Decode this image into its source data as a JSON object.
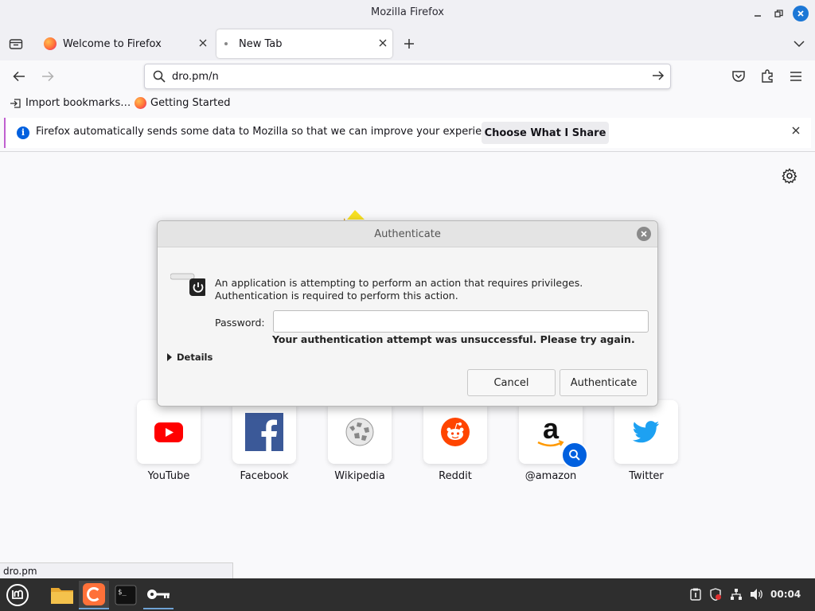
{
  "window": {
    "title": "Mozilla Firefox"
  },
  "tabs": [
    {
      "label": "Welcome to Firefox",
      "active": false
    },
    {
      "label": "New Tab",
      "active": true
    }
  ],
  "navbar": {
    "url": "dro.pm/n"
  },
  "bookmarks": [
    {
      "label": "Import bookmarks…"
    },
    {
      "label": "Getting Started"
    }
  ],
  "notification": {
    "message": "Firefox automatically sends some data to Mozilla so that we can improve your experience.",
    "button": "Choose What I Share"
  },
  "top_sites": [
    {
      "label": "YouTube"
    },
    {
      "label": "Facebook"
    },
    {
      "label": "Wikipedia"
    },
    {
      "label": "Reddit"
    },
    {
      "label": "@amazon"
    },
    {
      "label": "Twitter"
    }
  ],
  "dialog": {
    "title": "Authenticate",
    "message": "An application is attempting to perform an action that requires privileges. Authentication is required to perform this action.",
    "password_label": "Password:",
    "password_value": "",
    "error": "Your authentication attempt was unsuccessful. Please try again.",
    "details_label": "Details",
    "cancel_label": "Cancel",
    "authenticate_label": "Authenticate"
  },
  "status_bar": {
    "text": "dro.pm"
  },
  "taskbar": {
    "clock": "00:04"
  },
  "colors": {
    "accent": "#0060df",
    "taskbar": "#2e2e2e",
    "firefox_orange": "#ff7139"
  }
}
